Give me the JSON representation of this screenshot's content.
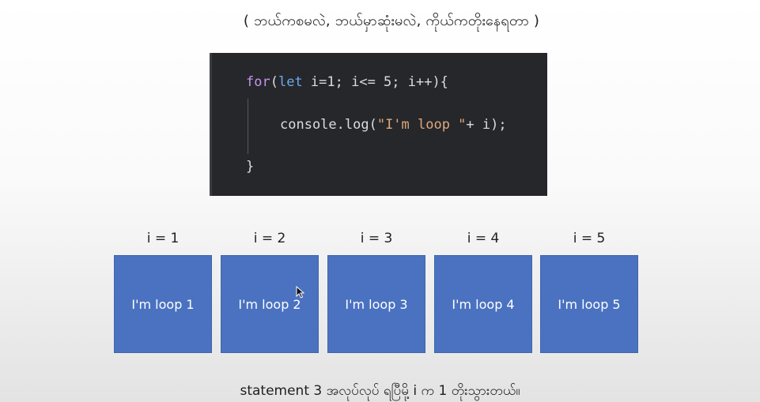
{
  "heading": "( ဘယ်ကစမလဲ, ဘယ်မှာဆုံးမလဲ, ကိုယ်ကတိုးနေရတာ )",
  "code": {
    "line1": {
      "kw_for": "for",
      "p1": "(",
      "kw_let": "let",
      "p2": " i=1; i<= 5; i++){"
    },
    "line2": {
      "p1": "console.log(",
      "str": "\"I'm loop \"",
      "p2": "+ i);"
    },
    "line3": "}"
  },
  "iterations": [
    {
      "label": "i = 1",
      "box_text": "I'm loop 1"
    },
    {
      "label": "i = 2",
      "box_text": "I'm loop 2"
    },
    {
      "label": "i = 3",
      "box_text": "I'm loop 3"
    },
    {
      "label": "i = 4",
      "box_text": "I'm loop 4"
    },
    {
      "label": "i = 5",
      "box_text": "I'm loop 5"
    }
  ],
  "footer": "statement 3 အလုပ်လုပ် ရပြီမို့ i က 1 တိုးသွားတယ်။",
  "colors": {
    "box_fill": "#4a72c0",
    "code_bg": "#25272b",
    "keyword_for": "#c792ea",
    "keyword_let": "#6ea8e8",
    "string": "#e0a879"
  },
  "icons": {
    "cursor": "mouse-pointer-icon"
  }
}
